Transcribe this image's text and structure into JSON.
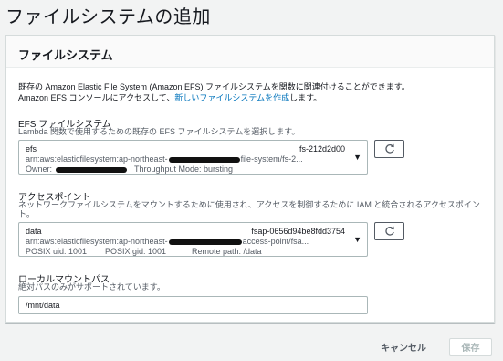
{
  "page": {
    "title": "ファイルシステムの追加"
  },
  "panel": {
    "header": "ファイルシステム",
    "intro_line1": "既存の Amazon Elastic File System (Amazon EFS) ファイルシステムを関数に関連付けることができます。",
    "intro_line2_before": "Amazon EFS コンソールにアクセスして、",
    "intro_link": "新しいファイルシステムを作成",
    "intro_line2_after": "します。"
  },
  "efs": {
    "label": "EFS ファイルシステム",
    "description": "Lambda 関数で使用するための既存の EFS ファイルシステムを選択します。",
    "name": "efs",
    "id": "fs-212d2d00",
    "arn_prefix": "arn:aws:elasticfilesystem:ap-northeast-",
    "arn_suffix": "file-system/fs-2...",
    "owner_label": "Owner:",
    "throughput": "Throughput Mode: bursting"
  },
  "access_point": {
    "label": "アクセスポイント",
    "description": "ネットワークファイルシステムをマウントするために使用され、アクセスを制御するために IAM と統合されるアクセスポイント。",
    "name": "data",
    "id": "fsap-0656d94be8fdd3754",
    "arn_prefix": "arn:aws:elasticfilesystem:ap-northeast-",
    "arn_suffix": "access-point/fsa...",
    "posix_uid": "POSIX uid: 1001",
    "posix_gid": "POSIX gid: 1001",
    "remote_path": "Remote path: /data"
  },
  "mount": {
    "label": "ローカルマウントパス",
    "description": "絶対パスのみがサポートされています。",
    "value": "/mnt/data"
  },
  "footer": {
    "cancel": "キャンセル",
    "save": "保存"
  },
  "colors": {
    "link": "#0073bb",
    "border": "#aab7b8",
    "disabled_text": "#aab7b8"
  },
  "icons": {
    "refresh": "refresh-icon",
    "caret": "caret-down-icon"
  }
}
